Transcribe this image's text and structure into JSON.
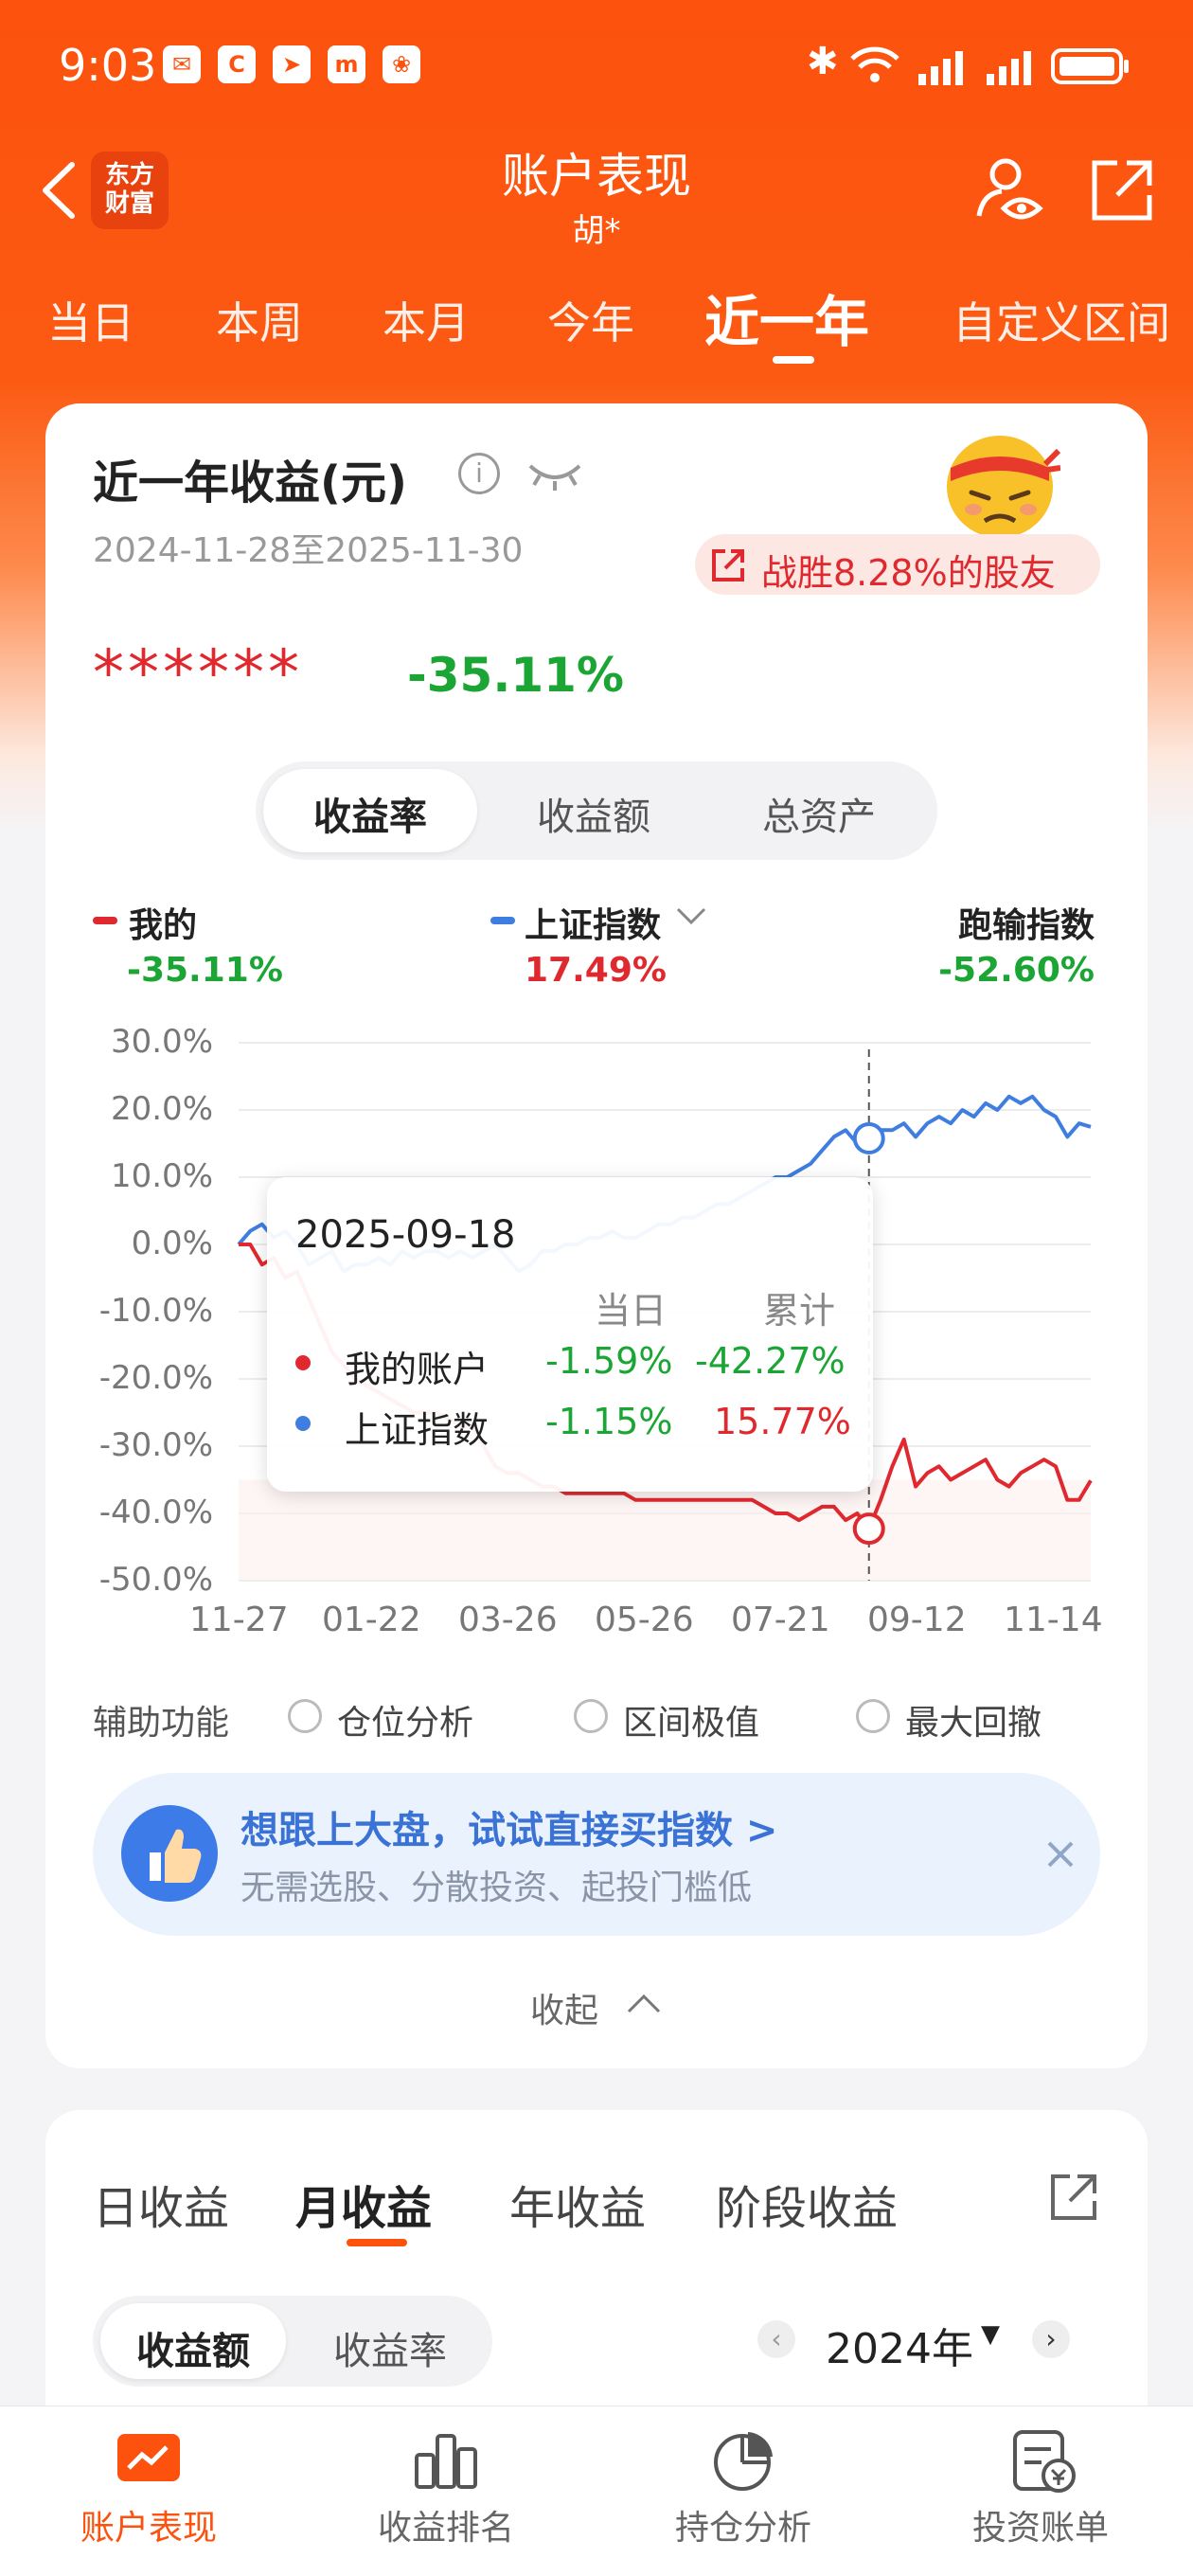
{
  "status": {
    "time": "9:03"
  },
  "header": {
    "title": "账户表现",
    "subtitle": "胡*",
    "logo_line1": "东方",
    "logo_line2": "财富"
  },
  "period_tabs": [
    "当日",
    "本周",
    "本月",
    "今年",
    "近一年",
    "自定义区间"
  ],
  "summary": {
    "title": "近一年收益(元)",
    "date_range": "2024-11-28至2025-11-30",
    "masked_value": "******",
    "return": "-35.11%",
    "beat_text": "战胜8.28%的股友"
  },
  "metric_tabs": [
    "收益率",
    "收益额",
    "总资产"
  ],
  "legend": [
    {
      "name": "我的",
      "value": "-35.11%",
      "value_color": "#1ba535",
      "mark_color": "#e0292e"
    },
    {
      "name": "上证指数",
      "value": "17.49%",
      "value_color": "#e0292e",
      "mark_color": "#3f7ee0"
    },
    {
      "name": "跑输指数",
      "value": "-52.60%",
      "value_color": "#1ba535",
      "mark_color": ""
    }
  ],
  "chart_data": {
    "type": "line",
    "y_ticks": [
      "30.0%",
      "20.0%",
      "10.0%",
      "0.0%",
      "-10.0%",
      "-20.0%",
      "-30.0%",
      "-40.0%",
      "-50.0%"
    ],
    "x_ticks": [
      "11-27",
      "01-22",
      "03-26",
      "05-26",
      "07-21",
      "09-12",
      "11-14"
    ],
    "ylim": [
      -50,
      30
    ],
    "grid": true,
    "series": [
      {
        "name": "我的",
        "color": "#e0292e",
        "values": [
          0,
          0,
          -3,
          -2,
          -5,
          -4,
          -8,
          -12,
          -16,
          -18,
          -20,
          -21,
          -22,
          -23,
          -24,
          -25,
          -25,
          -25,
          -26,
          -27,
          -27,
          -30,
          -33,
          -34,
          -34,
          -35,
          -36,
          -36,
          -37,
          -37,
          -37,
          -37,
          -37,
          -37,
          -38,
          -38,
          -38,
          -38,
          -38,
          -38,
          -38,
          -38,
          -38,
          -38,
          -38,
          -39,
          -40,
          -40,
          -41,
          -40,
          -39,
          -39,
          -41,
          -40,
          -42.27,
          -38,
          -33,
          -29,
          -36,
          -34,
          -33,
          -35,
          -34,
          -33,
          -32,
          -35,
          -36,
          -34,
          -33,
          -32,
          -33,
          -38,
          -38,
          -35.11
        ]
      },
      {
        "name": "上证指数",
        "color": "#3f7ee0",
        "values": [
          0,
          2,
          3,
          1,
          2,
          0,
          -3,
          -2,
          -1,
          -4,
          -3,
          -3,
          -2,
          -3,
          -1,
          -2,
          -1,
          -1,
          -2,
          -1,
          -2,
          -1,
          0,
          -2,
          -4,
          -3,
          -1,
          -1,
          0,
          0,
          1,
          1,
          2,
          1,
          1,
          2,
          3,
          3,
          4,
          4,
          5,
          6,
          6,
          7,
          8,
          9,
          10,
          10,
          11,
          12,
          14,
          16,
          17,
          15,
          15.77,
          17,
          17,
          18,
          16,
          18,
          19,
          18,
          20,
          19,
          21,
          20,
          22,
          21,
          22,
          20,
          19,
          16,
          18,
          17.49
        ]
      }
    ],
    "tooltip": {
      "date": "2025-09-18",
      "col_day": "当日",
      "col_total": "累计",
      "rows": [
        {
          "name": "我的账户",
          "day": "-1.59%",
          "total": "-42.27%"
        },
        {
          "name": "上证指数",
          "day": "-1.15%",
          "total": "15.77%"
        }
      ]
    }
  },
  "aux": {
    "label": "辅助功能",
    "options": [
      "仓位分析",
      "区间极值",
      "最大回撤"
    ]
  },
  "promo": {
    "title": "想跟上大盘，试试直接买指数 >",
    "subtitle": "无需选股、分散投资、起投门槛低"
  },
  "collapse_label": "收起",
  "period_section": {
    "tabs": [
      "日收益",
      "月收益",
      "年收益",
      "阶段收益"
    ],
    "seg": [
      "收益额",
      "收益率"
    ],
    "year": "2024年"
  },
  "bottom_nav": [
    "账户表现",
    "收益排名",
    "持仓分析",
    "投资账单"
  ],
  "colors": {
    "brand": "#fc520e",
    "up": "#e0292e",
    "down": "#1ba535",
    "index": "#3f7ee0"
  }
}
